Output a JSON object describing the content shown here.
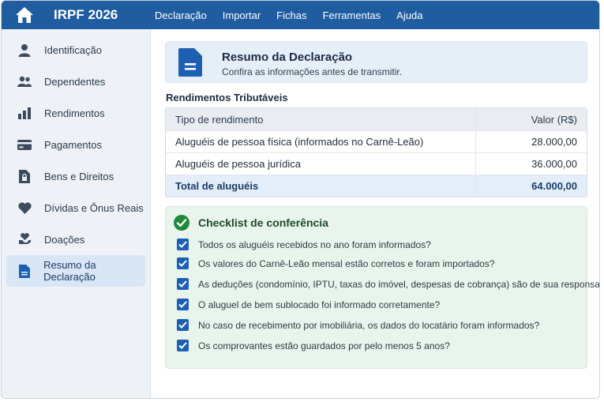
{
  "app": {
    "title": "IRPF 2026"
  },
  "menu": [
    "Declaração",
    "Importar",
    "Fichas",
    "Ferramentas",
    "Ajuda"
  ],
  "sidebar": {
    "items": [
      {
        "label": "Identificação",
        "icon": "person-icon"
      },
      {
        "label": "Dependentes",
        "icon": "people-icon"
      },
      {
        "label": "Rendimentos",
        "icon": "bar-chart-icon"
      },
      {
        "label": "Pagamentos",
        "icon": "credit-card-icon"
      },
      {
        "label": "Bens e Direitos",
        "icon": "lock-document-icon"
      },
      {
        "label": "Dívidas e Ônus Reais",
        "icon": "heart-icon"
      },
      {
        "label": "Doações",
        "icon": "hand-heart-icon"
      },
      {
        "label": "Resumo da Declaração",
        "icon": "document-icon",
        "active": true
      }
    ]
  },
  "summary": {
    "title": "Resumo da Declaração",
    "subtitle": "Confira as informações antes de transmitir."
  },
  "rendimentos": {
    "title": "Rendimentos Tributáveis",
    "headers": [
      "Tipo de rendimento",
      "Valor (R$)"
    ],
    "rows": [
      {
        "tipo": "Aluguéis de pessoa física (informados no Carnê-Leão)",
        "valor": "28.000,00"
      },
      {
        "tipo": "Aluguéis de pessoa jurídica",
        "valor": "36.000,00"
      }
    ],
    "total": {
      "label": "Total de aluguéis",
      "valor": "64.000,00"
    }
  },
  "checklist": {
    "title": "Checklist de conferência",
    "items": [
      "Todos os aluguéis recebidos no ano foram informados?",
      "Os valores do Carnê-Leão mensal estão corretos e foram importados?",
      "As deduções (condomínio, IPTU, taxas do imóvel, despesas de cobrança) são de sua responsabilidade?",
      "O aluguel de bem sublocado foi informado corretamente?",
      "No caso de recebimento por imobiliária, os dados do locatário foram informados?",
      "Os comprovantes estão guardados por pelo menos 5 anos?"
    ]
  },
  "colors": {
    "topbar": "#1f5ca0",
    "accent": "#1c5fb3",
    "sidebar_bg": "#eef2f7",
    "active_item_bg": "#d8e6f6",
    "checklist_bg": "#e9f4ec",
    "check_green": "#1f8a3a"
  }
}
